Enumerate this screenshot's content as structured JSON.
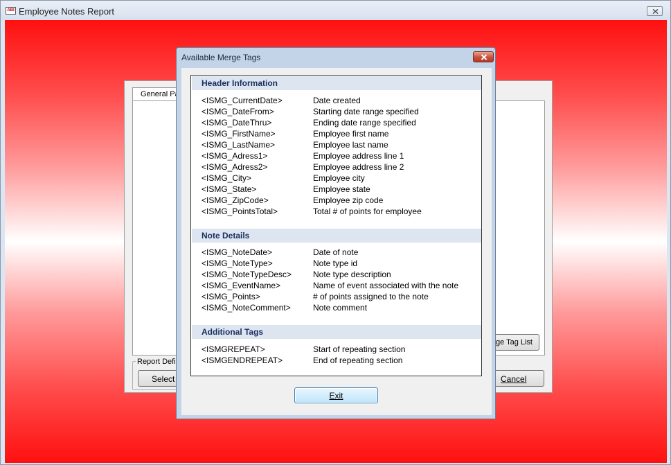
{
  "window": {
    "title": "Employee Notes Report",
    "logo_text": "ABI"
  },
  "background_form": {
    "tab_label": "General Pa",
    "merge_tag_button": "ge Tag List",
    "group_label": "Report Defin",
    "select_button": "Select",
    "cancel_button": "Cancel"
  },
  "dialog": {
    "title": "Available Merge Tags",
    "exit_button": "Exit",
    "sections": [
      {
        "header": "Header Information",
        "rows": [
          {
            "tag": "<ISMG_CurrentDate>",
            "desc": "Date created"
          },
          {
            "tag": "<ISMG_DateFrom>",
            "desc": "Starting date range specified"
          },
          {
            "tag": "<ISMG_DateThru>",
            "desc": "Ending date range specified"
          },
          {
            "tag": "<ISMG_FirstName>",
            "desc": "Employee first name"
          },
          {
            "tag": "<ISMG_LastName>",
            "desc": "Employee last name"
          },
          {
            "tag": "<ISMG_Adress1>",
            "desc": "Employee address line 1"
          },
          {
            "tag": "<ISMG_Adress2>",
            "desc": "Employee address line 2"
          },
          {
            "tag": "<ISMG_City>",
            "desc": "Employee city"
          },
          {
            "tag": "<ISMG_State>",
            "desc": "Employee state"
          },
          {
            "tag": "<ISMG_ZipCode>",
            "desc": "Employee zip code"
          },
          {
            "tag": "<ISMG_PointsTotal>",
            "desc": "Total # of points for employee"
          }
        ]
      },
      {
        "header": "Note Details",
        "rows": [
          {
            "tag": "<ISMG_NoteDate>",
            "desc": "Date of note"
          },
          {
            "tag": "<ISMG_NoteType>",
            "desc": "Note type id"
          },
          {
            "tag": "<ISMG_NoteTypeDesc>",
            "desc": "Note type description"
          },
          {
            "tag": "<ISMG_EventName>",
            "desc": "Name of event associated with the note"
          },
          {
            "tag": "<ISMG_Points>",
            "desc": "# of points assigned to the note"
          },
          {
            "tag": "<ISMG_NoteComment>",
            "desc": "Note comment"
          }
        ]
      },
      {
        "header": "Additional Tags",
        "rows": [
          {
            "tag": "<ISMGREPEAT>",
            "desc": "Start of repeating section"
          },
          {
            "tag": "<ISMGENDREPEAT>",
            "desc": "End of repeating section"
          }
        ]
      }
    ]
  }
}
